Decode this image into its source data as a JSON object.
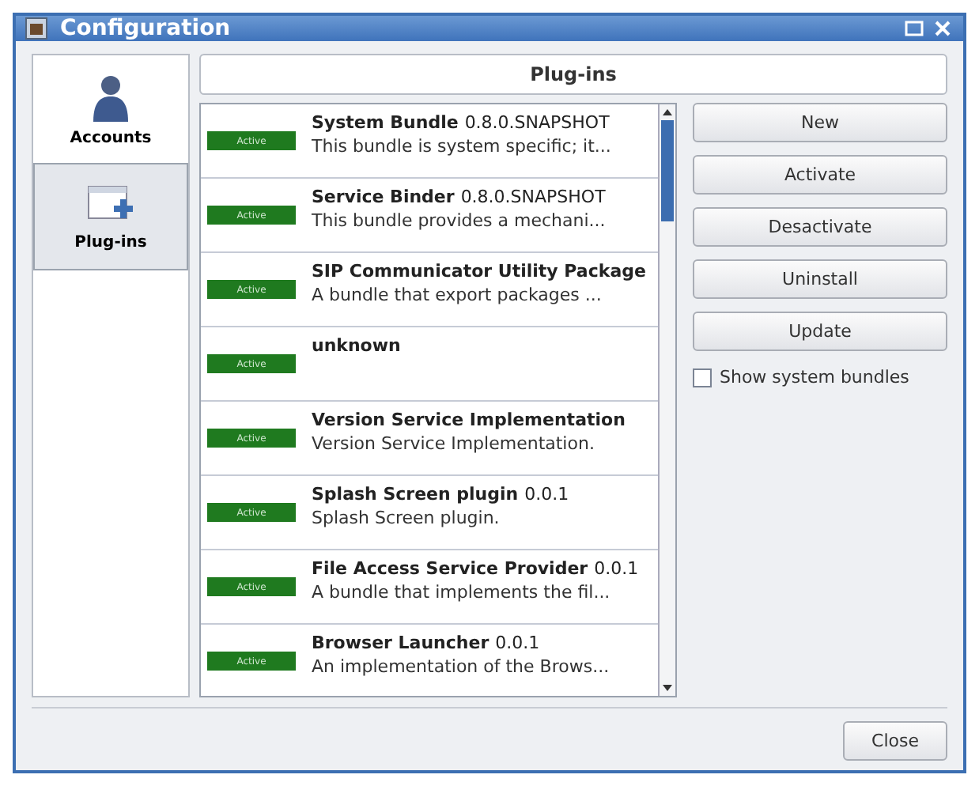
{
  "window": {
    "title": "Configuration"
  },
  "sidebar": {
    "items": [
      {
        "label": "Accounts",
        "kind": "accounts",
        "selected": false
      },
      {
        "label": "Plug-ins",
        "kind": "plugins",
        "selected": true
      }
    ]
  },
  "panel": {
    "title": "Plug-ins"
  },
  "plugins": [
    {
      "status": "Active",
      "name": "System Bundle",
      "version": "0.8.0.SNAPSHOT",
      "description": "This bundle is system specific; it..."
    },
    {
      "status": "Active",
      "name": "Service Binder",
      "version": "0.8.0.SNAPSHOT",
      "description": "This bundle provides a mechani..."
    },
    {
      "status": "Active",
      "name": "SIP Communicator Utility Package",
      "description": "A bundle that export packages ..."
    },
    {
      "status": "Active",
      "name": "unknown"
    },
    {
      "status": "Active",
      "name": "Version Service Implementation",
      "description": "Version Service Implementation."
    },
    {
      "status": "Active",
      "name": "Splash Screen plugin",
      "version": "0.0.1",
      "description": "Splash Screen plugin."
    },
    {
      "status": "Active",
      "name": "File Access Service Provider",
      "version": "0.0.1",
      "description": "A bundle that implements the fil..."
    },
    {
      "status": "Active",
      "name": "Browser Launcher",
      "version": "0.0.1",
      "description": "An implementation of the Brows..."
    }
  ],
  "buttons": [
    "New",
    "Activate",
    "Desactivate",
    "Uninstall",
    "Update"
  ],
  "show_system_bundles": {
    "label": "Show system bundles",
    "checked": false
  },
  "close_button": "Close"
}
